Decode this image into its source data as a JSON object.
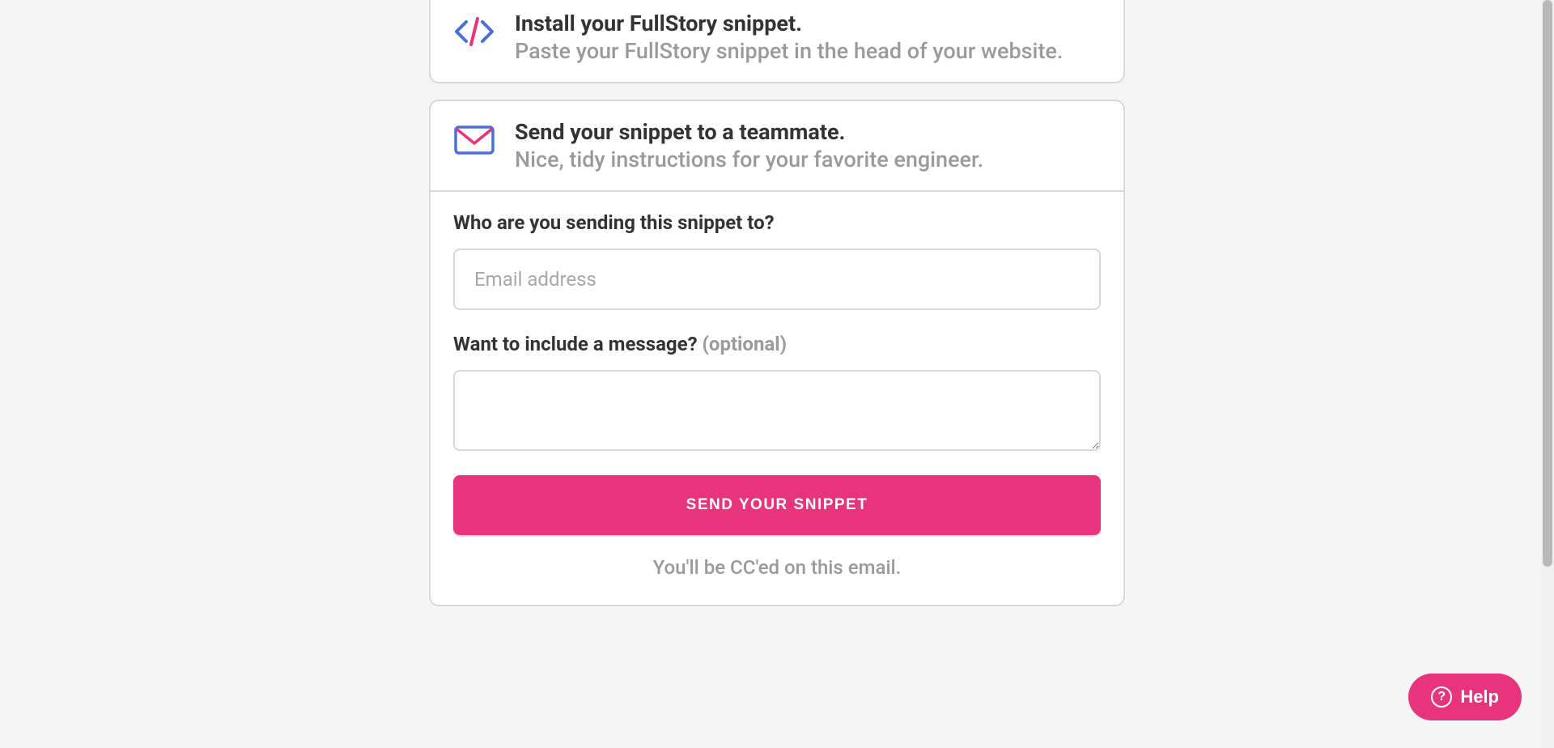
{
  "install_card": {
    "title": "Install your FullStory snippet.",
    "subtitle": "Paste your FullStory snippet in the head of your website."
  },
  "send_card": {
    "title": "Send your snippet to a teammate.",
    "subtitle": "Nice, tidy instructions for your favorite engineer.",
    "email_label": "Who are you sending this snippet to?",
    "email_placeholder": "Email address",
    "message_label": "Want to include a message? ",
    "message_optional": "(optional)",
    "submit_label": "SEND YOUR SNIPPET",
    "cc_note": "You'll be CC'ed on this email."
  },
  "help": {
    "label": "Help"
  }
}
